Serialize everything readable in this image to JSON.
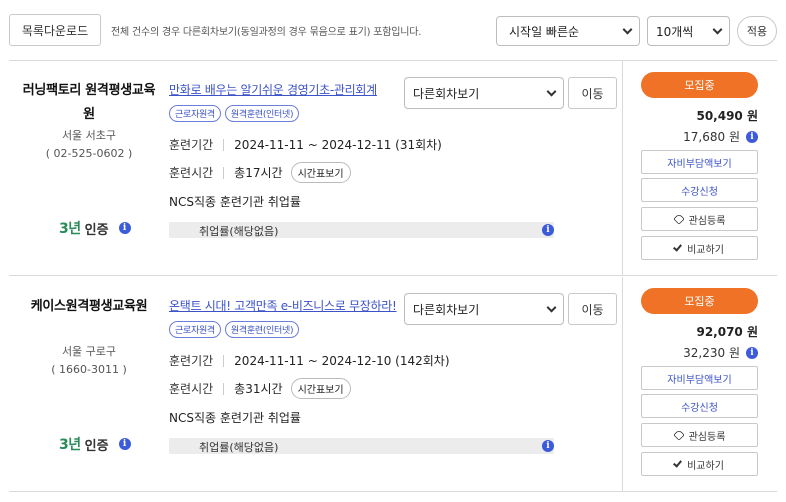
{
  "toolbar": {
    "download_label": "목록다운로드",
    "notice": "전체 건수의 경우 다른회차보기(동일과정의 경우 묶음으로 표기) 포함입니다.",
    "sort_value": "시작일 빠른순",
    "count_value": "10개씩",
    "apply_label": "적용"
  },
  "courses": [
    {
      "institution": "러닝팩토리 원격평생교육원",
      "region": "서울 서초구",
      "phone": "( 02-525-0602 )",
      "cert_years": "3년",
      "cert_label": "인증",
      "title": "만화로 배우는 알기쉬운 경영기초-관리회계",
      "tags": [
        "근로자원격",
        "원격훈련(인터넷)"
      ],
      "round_select": "다른회차보기",
      "move_label": "이동",
      "period_label": "훈련기간",
      "period_value": "2024-11-11 ~ 2024-12-11 (31회차)",
      "hours_label": "훈련시간",
      "hours_value": "총17시간",
      "timetable_label": "시간표보기",
      "ncs_text": "NCS직종 훈련기관 취업률",
      "rate_text": "취업률(해당없음)",
      "status": "모집중",
      "price_main": "50,490 원",
      "price_sub": "17,680 원",
      "btn_selfpay": "자비부담액보기",
      "btn_apply": "수강신청",
      "btn_wish": "관심등록",
      "btn_compare": "비교하기"
    },
    {
      "institution": "케이스원격평생교육원",
      "region": "서울 구로구",
      "phone": "( 1660-3011 )",
      "cert_years": "3년",
      "cert_label": "인증",
      "title": "온택트 시대! 고객만족 e-비즈니스로 무장하라!",
      "tags": [
        "근로자원격",
        "원격훈련(인터넷)"
      ],
      "round_select": "다른회차보기",
      "move_label": "이동",
      "period_label": "훈련기간",
      "period_value": "2024-11-11 ~ 2024-12-10 (142회차)",
      "hours_label": "훈련시간",
      "hours_value": "총31시간",
      "timetable_label": "시간표보기",
      "ncs_text": "NCS직종 훈련기관 취업률",
      "rate_text": "취업률(해당없음)",
      "status": "모집중",
      "price_main": "92,070 원",
      "price_sub": "32,230 원",
      "btn_selfpay": "자비부담액보기",
      "btn_apply": "수강신청",
      "btn_wish": "관심등록",
      "btn_compare": "비교하기"
    }
  ],
  "icons": {
    "info": "i"
  },
  "colors": {
    "accent": "#f07226",
    "link": "#3c52c7",
    "cert": "#2c8a5a",
    "info": "#3b5bdb"
  }
}
